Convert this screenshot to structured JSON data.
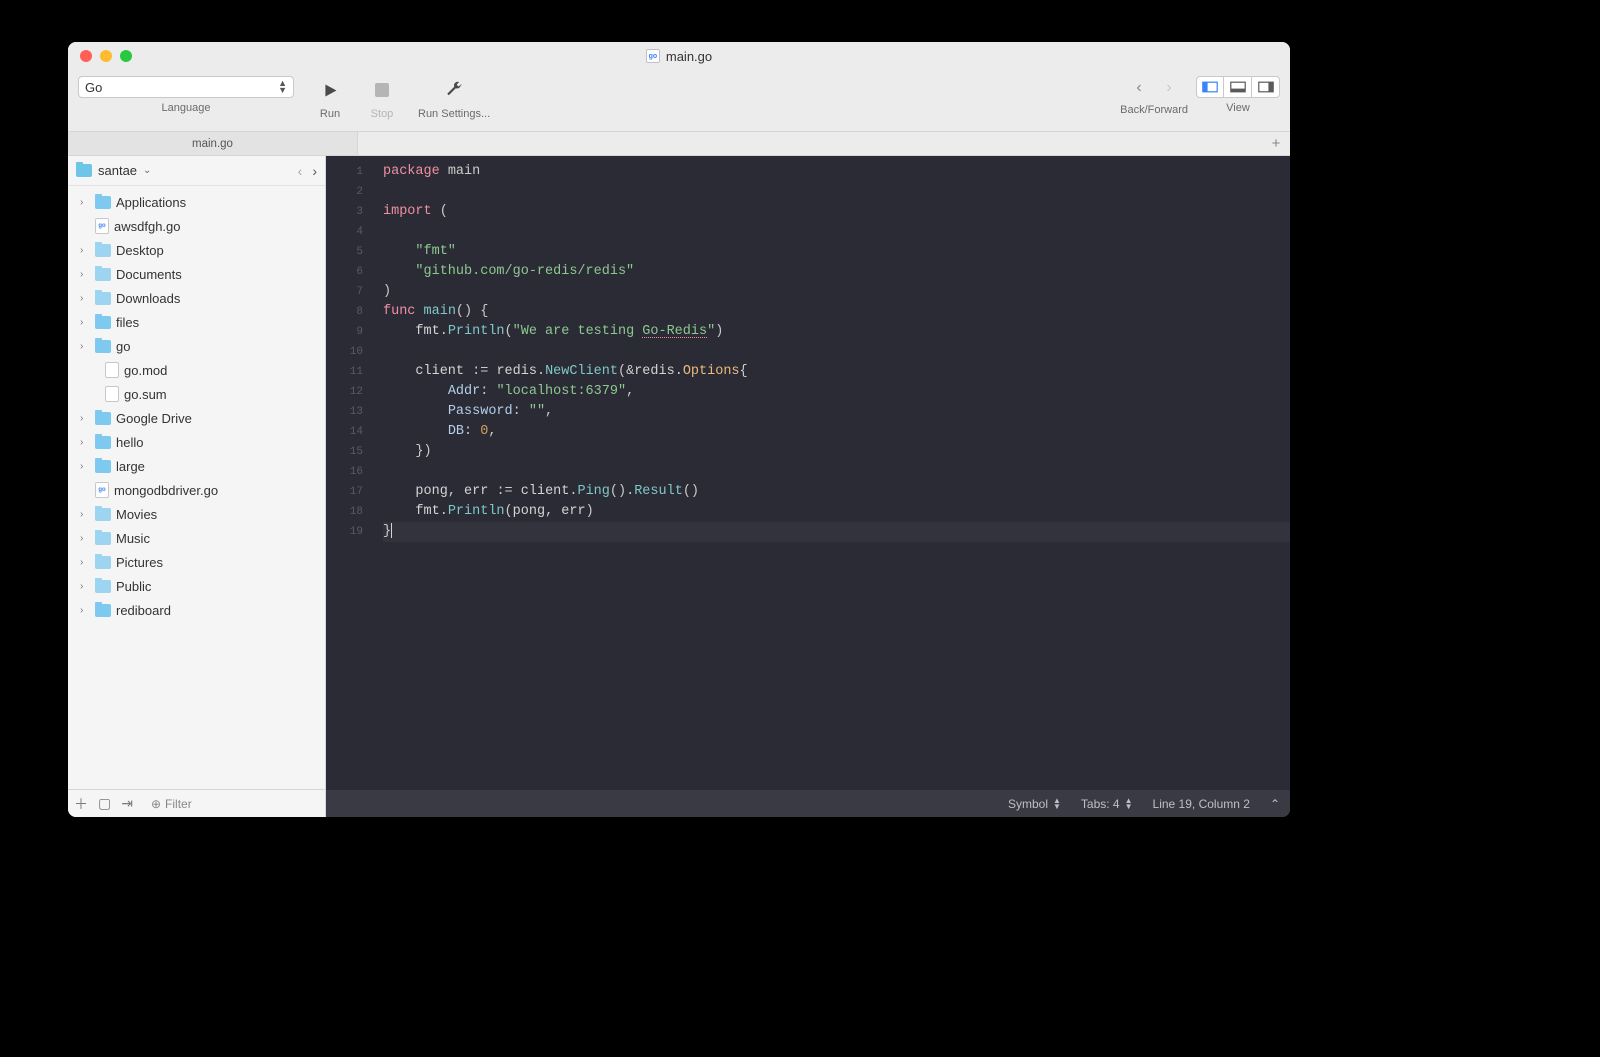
{
  "window": {
    "title": "main.go"
  },
  "toolbar": {
    "language": "Go",
    "language_label": "Language",
    "run": "Run",
    "stop": "Stop",
    "run_settings": "Run Settings...",
    "back_forward": "Back/Forward",
    "view": "View"
  },
  "tabs": {
    "active": "main.go"
  },
  "sidebar": {
    "root": "santae",
    "items": [
      {
        "label": "Applications",
        "type": "folder",
        "children": true,
        "depth": 0
      },
      {
        "label": "awsdfgh.go",
        "type": "gofile",
        "children": false,
        "depth": 0
      },
      {
        "label": "Desktop",
        "type": "folder-alt",
        "children": true,
        "depth": 0
      },
      {
        "label": "Documents",
        "type": "folder-alt",
        "children": true,
        "depth": 0
      },
      {
        "label": "Downloads",
        "type": "folder-alt",
        "children": true,
        "depth": 0
      },
      {
        "label": "files",
        "type": "folder",
        "children": true,
        "depth": 0
      },
      {
        "label": "go",
        "type": "folder",
        "children": true,
        "depth": 0
      },
      {
        "label": "go.mod",
        "type": "file",
        "children": false,
        "depth": 1
      },
      {
        "label": "go.sum",
        "type": "file",
        "children": false,
        "depth": 1
      },
      {
        "label": "Google Drive",
        "type": "folder",
        "children": true,
        "depth": 0
      },
      {
        "label": "hello",
        "type": "folder",
        "children": true,
        "depth": 0
      },
      {
        "label": "large",
        "type": "folder",
        "children": true,
        "depth": 0
      },
      {
        "label": "mongodbdriver.go",
        "type": "gofile",
        "children": false,
        "depth": 0
      },
      {
        "label": "Movies",
        "type": "folder-alt",
        "children": true,
        "depth": 0
      },
      {
        "label": "Music",
        "type": "folder-alt",
        "children": true,
        "depth": 0
      },
      {
        "label": "Pictures",
        "type": "folder-alt",
        "children": true,
        "depth": 0
      },
      {
        "label": "Public",
        "type": "folder-alt",
        "children": true,
        "depth": 0
      },
      {
        "label": "rediboard",
        "type": "folder",
        "children": true,
        "depth": 0
      }
    ],
    "filter_placeholder": "Filter"
  },
  "editor": {
    "lines": [
      [
        [
          "kw",
          "package"
        ],
        [
          "sp",
          " "
        ],
        [
          "pkg",
          "main"
        ]
      ],
      [],
      [
        [
          "kw",
          "import"
        ],
        [
          "sp",
          " "
        ],
        [
          "punc",
          "("
        ]
      ],
      [],
      [
        [
          "sp",
          "    "
        ],
        [
          "str",
          "\"fmt\""
        ]
      ],
      [
        [
          "sp",
          "    "
        ],
        [
          "str",
          "\"github.com/go-redis/redis\""
        ]
      ],
      [
        [
          "punc",
          ")"
        ]
      ],
      [
        [
          "kw",
          "func"
        ],
        [
          "sp",
          " "
        ],
        [
          "fn",
          "main"
        ],
        [
          "punc",
          "()"
        ],
        [
          "sp",
          " "
        ],
        [
          "punc",
          "{"
        ]
      ],
      [
        [
          "sp",
          "    "
        ],
        [
          "id",
          "fmt"
        ],
        [
          "punc",
          "."
        ],
        [
          "fn",
          "Println"
        ],
        [
          "punc",
          "("
        ],
        [
          "str",
          "\"We are testing "
        ],
        [
          "str underline",
          "Go-Redis"
        ],
        [
          "str",
          "\""
        ],
        [
          "punc",
          ")"
        ]
      ],
      [],
      [
        [
          "sp",
          "    "
        ],
        [
          "id",
          "client"
        ],
        [
          "sp",
          " "
        ],
        [
          "punc",
          ":="
        ],
        [
          "sp",
          " "
        ],
        [
          "id",
          "redis"
        ],
        [
          "punc",
          "."
        ],
        [
          "fn",
          "NewClient"
        ],
        [
          "punc",
          "("
        ],
        [
          "punc",
          "&"
        ],
        [
          "id",
          "redis"
        ],
        [
          "punc",
          "."
        ],
        [
          "type",
          "Options"
        ],
        [
          "punc",
          "{"
        ]
      ],
      [
        [
          "sp",
          "        "
        ],
        [
          "prop",
          "Addr"
        ],
        [
          "punc",
          ":"
        ],
        [
          "sp",
          " "
        ],
        [
          "str",
          "\"localhost:6379\""
        ],
        [
          "punc",
          ","
        ]
      ],
      [
        [
          "sp",
          "        "
        ],
        [
          "prop",
          "Password"
        ],
        [
          "punc",
          ":"
        ],
        [
          "sp",
          " "
        ],
        [
          "str",
          "\"\""
        ],
        [
          "punc",
          ","
        ]
      ],
      [
        [
          "sp",
          "        "
        ],
        [
          "prop",
          "DB"
        ],
        [
          "punc",
          ":"
        ],
        [
          "sp",
          " "
        ],
        [
          "num",
          "0"
        ],
        [
          "punc",
          ","
        ]
      ],
      [
        [
          "sp",
          "    "
        ],
        [
          "punc",
          "})"
        ]
      ],
      [],
      [
        [
          "sp",
          "    "
        ],
        [
          "id",
          "pong"
        ],
        [
          "punc",
          ","
        ],
        [
          "sp",
          " "
        ],
        [
          "id",
          "err"
        ],
        [
          "sp",
          " "
        ],
        [
          "punc",
          ":="
        ],
        [
          "sp",
          " "
        ],
        [
          "id",
          "client"
        ],
        [
          "punc",
          "."
        ],
        [
          "fn",
          "Ping"
        ],
        [
          "punc",
          "()."
        ],
        [
          "fn",
          "Result"
        ],
        [
          "punc",
          "()"
        ]
      ],
      [
        [
          "sp",
          "    "
        ],
        [
          "id",
          "fmt"
        ],
        [
          "punc",
          "."
        ],
        [
          "fn",
          "Println"
        ],
        [
          "punc",
          "("
        ],
        [
          "id",
          "pong"
        ],
        [
          "punc",
          ","
        ],
        [
          "sp",
          " "
        ],
        [
          "id",
          "err"
        ],
        [
          "punc",
          ")"
        ]
      ],
      [
        [
          "punc",
          "}"
        ]
      ]
    ],
    "highlight_line": 19
  },
  "statusbar": {
    "symbol": "Symbol",
    "tabs": "Tabs: 4",
    "position": "Line 19, Column 2"
  }
}
